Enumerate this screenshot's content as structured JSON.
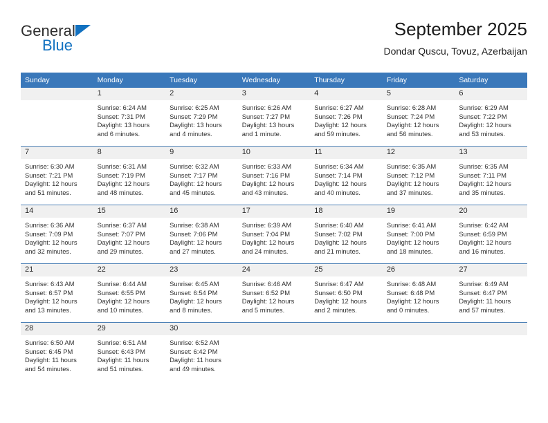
{
  "brand": {
    "name_top": "General",
    "name_bottom": "Blue"
  },
  "header": {
    "title": "September 2025",
    "subtitle": "Dondar Quscu, Tovuz, Azerbaijan"
  },
  "colors": {
    "header_blue": "#3a78ba",
    "brand_blue": "#1271c0",
    "daynum_band": "#f0f0f0",
    "row_divider": "#4a7fb5"
  },
  "calendar": {
    "weekday_headers": [
      "Sunday",
      "Monday",
      "Tuesday",
      "Wednesday",
      "Thursday",
      "Friday",
      "Saturday"
    ],
    "weeks": [
      [
        {
          "day": "",
          "lines": []
        },
        {
          "day": "1",
          "lines": [
            "Sunrise: 6:24 AM",
            "Sunset: 7:31 PM",
            "Daylight: 13 hours",
            "and 6 minutes."
          ]
        },
        {
          "day": "2",
          "lines": [
            "Sunrise: 6:25 AM",
            "Sunset: 7:29 PM",
            "Daylight: 13 hours",
            "and 4 minutes."
          ]
        },
        {
          "day": "3",
          "lines": [
            "Sunrise: 6:26 AM",
            "Sunset: 7:27 PM",
            "Daylight: 13 hours",
            "and 1 minute."
          ]
        },
        {
          "day": "4",
          "lines": [
            "Sunrise: 6:27 AM",
            "Sunset: 7:26 PM",
            "Daylight: 12 hours",
            "and 59 minutes."
          ]
        },
        {
          "day": "5",
          "lines": [
            "Sunrise: 6:28 AM",
            "Sunset: 7:24 PM",
            "Daylight: 12 hours",
            "and 56 minutes."
          ]
        },
        {
          "day": "6",
          "lines": [
            "Sunrise: 6:29 AM",
            "Sunset: 7:22 PM",
            "Daylight: 12 hours",
            "and 53 minutes."
          ]
        }
      ],
      [
        {
          "day": "7",
          "lines": [
            "Sunrise: 6:30 AM",
            "Sunset: 7:21 PM",
            "Daylight: 12 hours",
            "and 51 minutes."
          ]
        },
        {
          "day": "8",
          "lines": [
            "Sunrise: 6:31 AM",
            "Sunset: 7:19 PM",
            "Daylight: 12 hours",
            "and 48 minutes."
          ]
        },
        {
          "day": "9",
          "lines": [
            "Sunrise: 6:32 AM",
            "Sunset: 7:17 PM",
            "Daylight: 12 hours",
            "and 45 minutes."
          ]
        },
        {
          "day": "10",
          "lines": [
            "Sunrise: 6:33 AM",
            "Sunset: 7:16 PM",
            "Daylight: 12 hours",
            "and 43 minutes."
          ]
        },
        {
          "day": "11",
          "lines": [
            "Sunrise: 6:34 AM",
            "Sunset: 7:14 PM",
            "Daylight: 12 hours",
            "and 40 minutes."
          ]
        },
        {
          "day": "12",
          "lines": [
            "Sunrise: 6:35 AM",
            "Sunset: 7:12 PM",
            "Daylight: 12 hours",
            "and 37 minutes."
          ]
        },
        {
          "day": "13",
          "lines": [
            "Sunrise: 6:35 AM",
            "Sunset: 7:11 PM",
            "Daylight: 12 hours",
            "and 35 minutes."
          ]
        }
      ],
      [
        {
          "day": "14",
          "lines": [
            "Sunrise: 6:36 AM",
            "Sunset: 7:09 PM",
            "Daylight: 12 hours",
            "and 32 minutes."
          ]
        },
        {
          "day": "15",
          "lines": [
            "Sunrise: 6:37 AM",
            "Sunset: 7:07 PM",
            "Daylight: 12 hours",
            "and 29 minutes."
          ]
        },
        {
          "day": "16",
          "lines": [
            "Sunrise: 6:38 AM",
            "Sunset: 7:06 PM",
            "Daylight: 12 hours",
            "and 27 minutes."
          ]
        },
        {
          "day": "17",
          "lines": [
            "Sunrise: 6:39 AM",
            "Sunset: 7:04 PM",
            "Daylight: 12 hours",
            "and 24 minutes."
          ]
        },
        {
          "day": "18",
          "lines": [
            "Sunrise: 6:40 AM",
            "Sunset: 7:02 PM",
            "Daylight: 12 hours",
            "and 21 minutes."
          ]
        },
        {
          "day": "19",
          "lines": [
            "Sunrise: 6:41 AM",
            "Sunset: 7:00 PM",
            "Daylight: 12 hours",
            "and 18 minutes."
          ]
        },
        {
          "day": "20",
          "lines": [
            "Sunrise: 6:42 AM",
            "Sunset: 6:59 PM",
            "Daylight: 12 hours",
            "and 16 minutes."
          ]
        }
      ],
      [
        {
          "day": "21",
          "lines": [
            "Sunrise: 6:43 AM",
            "Sunset: 6:57 PM",
            "Daylight: 12 hours",
            "and 13 minutes."
          ]
        },
        {
          "day": "22",
          "lines": [
            "Sunrise: 6:44 AM",
            "Sunset: 6:55 PM",
            "Daylight: 12 hours",
            "and 10 minutes."
          ]
        },
        {
          "day": "23",
          "lines": [
            "Sunrise: 6:45 AM",
            "Sunset: 6:54 PM",
            "Daylight: 12 hours",
            "and 8 minutes."
          ]
        },
        {
          "day": "24",
          "lines": [
            "Sunrise: 6:46 AM",
            "Sunset: 6:52 PM",
            "Daylight: 12 hours",
            "and 5 minutes."
          ]
        },
        {
          "day": "25",
          "lines": [
            "Sunrise: 6:47 AM",
            "Sunset: 6:50 PM",
            "Daylight: 12 hours",
            "and 2 minutes."
          ]
        },
        {
          "day": "26",
          "lines": [
            "Sunrise: 6:48 AM",
            "Sunset: 6:48 PM",
            "Daylight: 12 hours",
            "and 0 minutes."
          ]
        },
        {
          "day": "27",
          "lines": [
            "Sunrise: 6:49 AM",
            "Sunset: 6:47 PM",
            "Daylight: 11 hours",
            "and 57 minutes."
          ]
        }
      ],
      [
        {
          "day": "28",
          "lines": [
            "Sunrise: 6:50 AM",
            "Sunset: 6:45 PM",
            "Daylight: 11 hours",
            "and 54 minutes."
          ]
        },
        {
          "day": "29",
          "lines": [
            "Sunrise: 6:51 AM",
            "Sunset: 6:43 PM",
            "Daylight: 11 hours",
            "and 51 minutes."
          ]
        },
        {
          "day": "30",
          "lines": [
            "Sunrise: 6:52 AM",
            "Sunset: 6:42 PM",
            "Daylight: 11 hours",
            "and 49 minutes."
          ]
        },
        {
          "day": "",
          "lines": []
        },
        {
          "day": "",
          "lines": []
        },
        {
          "day": "",
          "lines": []
        },
        {
          "day": "",
          "lines": []
        }
      ]
    ]
  }
}
